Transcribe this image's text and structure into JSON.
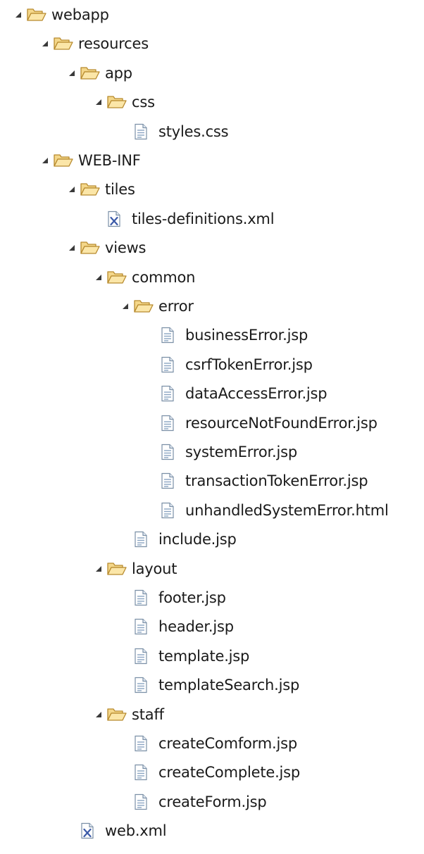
{
  "tree": [
    {
      "label": "webapp",
      "type": "folder",
      "depth": 0,
      "expanded": true
    },
    {
      "label": "resources",
      "type": "folder",
      "depth": 1,
      "expanded": true
    },
    {
      "label": "app",
      "type": "folder",
      "depth": 2,
      "expanded": true
    },
    {
      "label": "css",
      "type": "folder",
      "depth": 3,
      "expanded": true
    },
    {
      "label": "styles.css",
      "type": "file",
      "depth": 4
    },
    {
      "label": "WEB-INF",
      "type": "folder",
      "depth": 1,
      "expanded": true
    },
    {
      "label": "tiles",
      "type": "folder",
      "depth": 2,
      "expanded": true
    },
    {
      "label": "tiles-definitions.xml",
      "type": "xml",
      "depth": 3
    },
    {
      "label": "views",
      "type": "folder",
      "depth": 2,
      "expanded": true
    },
    {
      "label": "common",
      "type": "folder",
      "depth": 3,
      "expanded": true
    },
    {
      "label": "error",
      "type": "folder",
      "depth": 4,
      "expanded": true
    },
    {
      "label": "businessError.jsp",
      "type": "file",
      "depth": 5
    },
    {
      "label": "csrfTokenError.jsp",
      "type": "file",
      "depth": 5
    },
    {
      "label": "dataAccessError.jsp",
      "type": "file",
      "depth": 5
    },
    {
      "label": "resourceNotFoundError.jsp",
      "type": "file",
      "depth": 5
    },
    {
      "label": "systemError.jsp",
      "type": "file",
      "depth": 5
    },
    {
      "label": "transactionTokenError.jsp",
      "type": "file",
      "depth": 5
    },
    {
      "label": "unhandledSystemError.html",
      "type": "file",
      "depth": 5
    },
    {
      "label": "include.jsp",
      "type": "file",
      "depth": 4
    },
    {
      "label": "layout",
      "type": "folder",
      "depth": 3,
      "expanded": true
    },
    {
      "label": "footer.jsp",
      "type": "file",
      "depth": 4
    },
    {
      "label": "header.jsp",
      "type": "file",
      "depth": 4
    },
    {
      "label": "template.jsp",
      "type": "file",
      "depth": 4
    },
    {
      "label": "templateSearch.jsp",
      "type": "file",
      "depth": 4
    },
    {
      "label": "staff",
      "type": "folder",
      "depth": 3,
      "expanded": true
    },
    {
      "label": "createComform.jsp",
      "type": "file",
      "depth": 4
    },
    {
      "label": "createComplete.jsp",
      "type": "file",
      "depth": 4
    },
    {
      "label": "createForm.jsp",
      "type": "file",
      "depth": 4
    },
    {
      "label": "web.xml",
      "type": "xml",
      "depth": 2
    }
  ],
  "colors": {
    "folder_fill": "#f4d78a",
    "folder_stroke": "#b78a2e",
    "toggle": "#3a3a3a",
    "file_stroke": "#7a8fa6",
    "xml_accent": "#3b5aa8"
  },
  "icons": {
    "folder": "folder-open-icon",
    "file": "text-file-icon",
    "xml": "xml-file-icon",
    "toggle": "expanded-triangle-icon"
  }
}
